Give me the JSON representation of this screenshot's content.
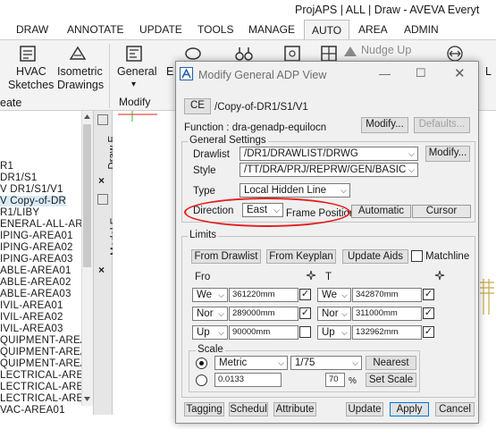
{
  "app": {
    "title": "ProjAPS | ALL | Draw - AVEVA Everyt"
  },
  "tabs": [
    {
      "label": "DRAW"
    },
    {
      "label": "ANNOTATE"
    },
    {
      "label": "UPDATE"
    },
    {
      "label": "TOOLS"
    },
    {
      "label": "MANAGE"
    },
    {
      "label": "AUTO"
    },
    {
      "label": "AREA"
    },
    {
      "label": "ADMIN"
    }
  ],
  "ribbon": {
    "hvac_line1": "HVAC",
    "hvac_line2": "Sketches",
    "iso_line1": "Isometric",
    "iso_line2": "Drawings",
    "general_label": "General",
    "general_dropdown": "▾",
    "modify_group": "Modify",
    "create_group_partial": "eate",
    "nudge_up": "Nudge Up",
    "l_partial": "L",
    "e_partial": "E"
  },
  "left_tree": [
    "R1",
    "DR1/S1",
    "V DR1/S1/V1",
    "V Copy-of-DR",
    "R1/LIBY",
    "ENERAL-ALL-AREA",
    "IPING-AREA01",
    "IPING-AREA02",
    "IPING-AREA03",
    "ABLE-AREA01",
    "ABLE-AREA02",
    "ABLE-AREA03",
    "IVIL-AREA01",
    "IVIL-AREA02",
    "IVIL-AREA03",
    "QUIPMENT-AREA(",
    "QUIPMENT-AREA(",
    "QUIPMENT-AREA(",
    "LECTRICAL-AREA",
    "LECTRICAL-AREA",
    "LECTRICAL-AREA",
    "VAC-AREA01"
  ],
  "vtabs": {
    "draw": "Draw E...",
    "model": "Model E...",
    "close": "×"
  },
  "dialog": {
    "title": "Modify General ADP View",
    "ce_button": "CE",
    "ce_value": "/Copy-of-DR1/S1/V1",
    "function_label": "Function : dra-genadp-equilocn",
    "modify_button": "Modify...",
    "defaults_button": "Defaults...",
    "general_settings": "General Settings",
    "drawlist_label": "Drawlist",
    "drawlist_value": "/DR1/DRAWLIST/DRWG",
    "drawlist_modify": "Modify...",
    "style_label": "Style",
    "style_value": "/TT/DRA/PRJ/REPRW/GEN/BASIC",
    "type_label": "Type",
    "type_value": "Local Hidden Line",
    "direction_label": "Direction",
    "direction_value": "East",
    "frame_position": "Frame Position",
    "automatic_button": "Automatic",
    "cursor_button": "Cursor",
    "limits": "Limits",
    "from_drawlist": "From Drawlist",
    "from_keyplan": "From Keyplan",
    "update_aids": "Update Aids",
    "matchline": "Matchline",
    "from_label": "Fro",
    "to_label": "T",
    "row1": {
      "dir_from": "We",
      "val_from": "361220mm",
      "dir_to": "We",
      "val_to": "342870mm"
    },
    "row2": {
      "dir_from": "Nor",
      "val_from": "289000mm",
      "dir_to": "Nor",
      "val_to": "311000mm"
    },
    "row3": {
      "dir_from": "Up",
      "val_from": "90000mm",
      "dir_to": "Up",
      "val_to": "132962mm"
    },
    "scale": "Scale",
    "scale_unit": "Metric",
    "scale_ratio": "1/75",
    "nearest_button": "Nearest",
    "scale_value": "0.0133",
    "percent_value": "70",
    "percent_sign": "%",
    "set_scale_button": "Set Scale",
    "tagging_button": "Tagging",
    "schedul_button": "Schedul",
    "attribute_button": "Attribute",
    "update_button": "Update",
    "apply_button": "Apply",
    "cancel_button": "Cancel"
  },
  "colors": {
    "accent": "#0078d7",
    "annotation_red": "#e41e1e",
    "selection": "#d9ebf9"
  }
}
